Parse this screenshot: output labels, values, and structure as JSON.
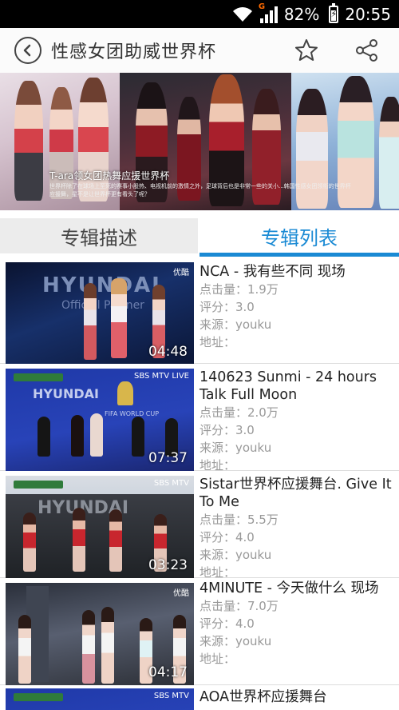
{
  "status_bar": {
    "network_label": "G",
    "battery_percent": "82%",
    "time": "20:55"
  },
  "header": {
    "title": "性感女团助威世界杯",
    "icons": [
      "back-icon",
      "star-icon",
      "share-icon"
    ]
  },
  "banner": {
    "caption": "T-ara领女团热舞应援世界杯",
    "description": "世界杯除了在球场上至死的赛事小股热、电视机前的激情之外，足球背后也是非常一些的关小...韩国性感女团领衔的世界杯应援舞，星不是让世界杯更有看头了呢？"
  },
  "tabs": [
    {
      "label": "专辑描述",
      "active": false
    },
    {
      "label": "专辑列表",
      "active": true
    }
  ],
  "colors": {
    "accent": "#1a8ad4",
    "meta_text": "#999999"
  },
  "labels": {
    "views": "点击量：",
    "rating": "评分：",
    "source": "来源：",
    "address": "地址："
  },
  "albums": [
    {
      "title": "NCA - 我有些不同 现场",
      "views": "点击量：1.9万",
      "rating": "评分：3.0",
      "source": "来源：youku",
      "address": "地址：",
      "duration": "04:48",
      "logo": "优酷"
    },
    {
      "title": "140623 Sunmi - 24 hours Talk Full Moon",
      "views": "点击量：2.0万",
      "rating": "评分：3.0",
      "source": "来源：youku",
      "address": "地址：",
      "duration": "07:37",
      "logo": "SBS MTV LIVE"
    },
    {
      "title": "Sistar世界杯应援舞台. Give It To Me",
      "views": "点击量：5.5万",
      "rating": "评分：4.0",
      "source": "来源：youku",
      "address": "地址：",
      "duration": "03:23",
      "logo": "SBS MTV"
    },
    {
      "title": "4MINUTE - 今天做什么 现场",
      "views": "点击量：7.0万",
      "rating": "评分：4.0",
      "source": "来源：youku",
      "address": "地址：",
      "duration": "04:17",
      "logo": "优酷"
    },
    {
      "title": "AOA世界杯应援舞台",
      "logo": "SBS MTV"
    }
  ]
}
